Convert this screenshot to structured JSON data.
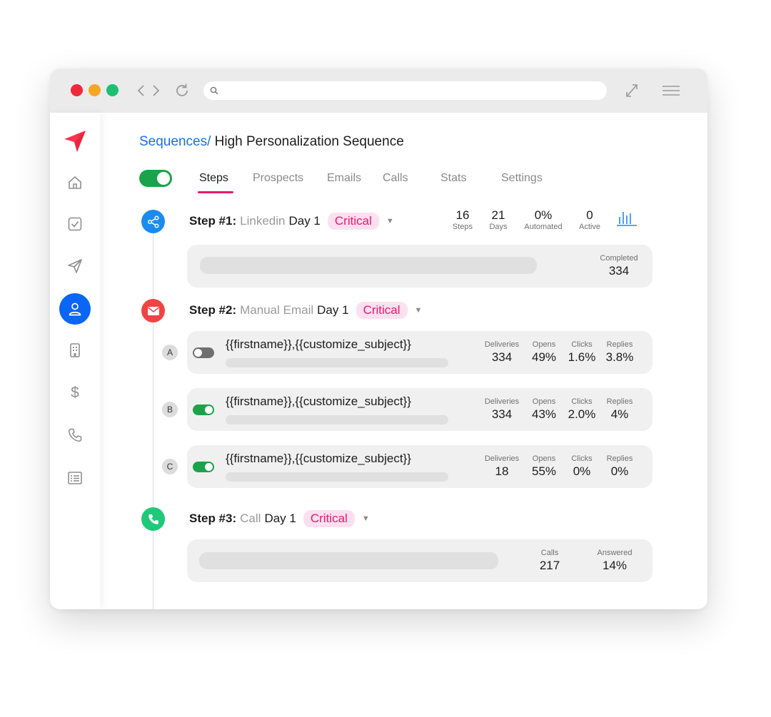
{
  "breadcrumb": {
    "link": "Sequences/",
    "title": "High Personalization Sequence"
  },
  "tabs": [
    {
      "label": "Steps",
      "active": true
    },
    {
      "label": "Prospects",
      "active": false
    },
    {
      "label": "Emails",
      "active": false
    },
    {
      "label": "Calls",
      "active": false
    },
    {
      "label": "Stats",
      "active": false
    },
    {
      "label": "Settings",
      "active": false
    }
  ],
  "summary": [
    {
      "value": "16",
      "label": "Steps"
    },
    {
      "value": "21",
      "label": "Days"
    },
    {
      "value": "0%",
      "label": "Automated"
    },
    {
      "value": "0",
      "label": "Active"
    }
  ],
  "steps": [
    {
      "number": "Step #1:",
      "kind": "Linkedin",
      "day": "Day 1",
      "badge": "Critical",
      "icon": "share-nodes-icon",
      "stats": [
        {
          "label": "Completed",
          "value": "334"
        }
      ]
    },
    {
      "number": "Step #2:",
      "kind": "Manual Email",
      "day": "Day 1",
      "badge": "Critical",
      "icon": "envelope-icon",
      "variants": [
        {
          "letter": "A",
          "enabled": false,
          "subject": "{{firstname}},{{customize_subject}}",
          "stats": [
            {
              "label": "Deliveries",
              "value": "334"
            },
            {
              "label": "Opens",
              "value": "49%"
            },
            {
              "label": "Clicks",
              "value": "1.6%"
            },
            {
              "label": "Replies",
              "value": "3.8%"
            }
          ]
        },
        {
          "letter": "B",
          "enabled": true,
          "subject": "{{firstname}},{{customize_subject}}",
          "stats": [
            {
              "label": "Deliveries",
              "value": "334"
            },
            {
              "label": "Opens",
              "value": "43%"
            },
            {
              "label": "Clicks",
              "value": "2.0%"
            },
            {
              "label": "Replies",
              "value": "4%"
            }
          ]
        },
        {
          "letter": "C",
          "enabled": true,
          "subject": "{{firstname}},{{customize_subject}}",
          "stats": [
            {
              "label": "Deliveries",
              "value": "18"
            },
            {
              "label": "Opens",
              "value": "55%"
            },
            {
              "label": "Clicks",
              "value": "0%"
            },
            {
              "label": "Replies",
              "value": "0%"
            }
          ]
        }
      ]
    },
    {
      "number": "Step #3:",
      "kind": "Call",
      "day": "Day 1",
      "badge": "Critical",
      "icon": "phone-icon",
      "stats": [
        {
          "label": "Calls",
          "value": "217"
        },
        {
          "label": "Answered",
          "value": "14%"
        }
      ]
    }
  ],
  "colors": {
    "accent": "#e8196d",
    "link": "#1a73d9",
    "toggle_on": "#1aa34a",
    "linkedin": "#1a8cf0",
    "email": "#ef4444",
    "call": "#1ec97a",
    "active_nav": "#0a66f5",
    "traffic_red": "#f0283c",
    "traffic_yellow": "#f5a623",
    "traffic_green": "#1ebf73"
  },
  "sidebar_icons": [
    "home-icon",
    "checkbox-icon",
    "send-icon",
    "user-icon",
    "building-icon",
    "dollar-icon",
    "phone-icon",
    "list-icon"
  ]
}
